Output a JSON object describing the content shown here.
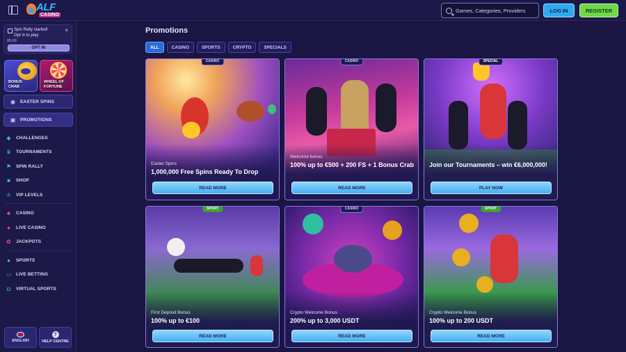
{
  "header": {
    "logo_text": "ALF",
    "logo_sub": "CASINO",
    "search_placeholder": "Games, Categories, Providers",
    "login_label": "LOG IN",
    "register_label": "REGISTER"
  },
  "sidebar": {
    "rally": {
      "title": "Spin Rally started!",
      "subtitle": "Opt in to play",
      "timer": "05:09",
      "opt_in": "OPT IN"
    },
    "tiles": {
      "bonus_crab": "BONUS CRAB",
      "wheel": "WHEEL OF FORTUNE"
    },
    "easter_spins": "EASTER SPINS",
    "promotions": "PROMOTIONS",
    "group1": [
      "CHALLENGES",
      "TOURNAMENTS",
      "SPIN RALLY",
      "SHOP",
      "VIP LEVELS"
    ],
    "group2": [
      "CASINO",
      "LIVE CASINO",
      "JACKPOTS"
    ],
    "group3": [
      "SPORTS",
      "LIVE BETTING",
      "VIRTUAL SPORTS"
    ],
    "language": "ENGLISH",
    "help": "HELP CENTRE"
  },
  "main": {
    "title": "Promotions",
    "filters": [
      "ALL",
      "CASINO",
      "SPORTS",
      "CRYPTO",
      "SPECIALS"
    ],
    "active_filter": "ALL",
    "cards": [
      {
        "badge": "CASINO",
        "subtitle": "Easter Spins",
        "title": "1,000,000 Free Spins Ready To Drop",
        "button": "READ MORE"
      },
      {
        "badge": "CASINO",
        "subtitle": "Welcome bonus",
        "title": "100% up to €500 + 200 FS + 1 Bonus Crab",
        "button": "READ MORE"
      },
      {
        "badge": "SPECIAL",
        "subtitle": "",
        "title": "Join our Tournaments – win €6,000,000!",
        "button": "PLAY NOW"
      },
      {
        "badge": "SPORT",
        "subtitle": "First Deposit Bonus",
        "title": "100% up to €100",
        "button": "READ MORE"
      },
      {
        "badge": "CASINO",
        "subtitle": "Crypto Welcome Bonus",
        "title": "200% up to 3,000 USDT",
        "button": "READ MORE"
      },
      {
        "badge": "SPORT",
        "subtitle": "Crypto Welcome Bonus",
        "title": "100% up to 200 USDT",
        "button": "READ MORE"
      }
    ]
  },
  "colors": {
    "background": "#1a1542",
    "accent_blue": "#46aef0",
    "register_green": "#6fd84a",
    "card_border": "#8a7be0"
  }
}
